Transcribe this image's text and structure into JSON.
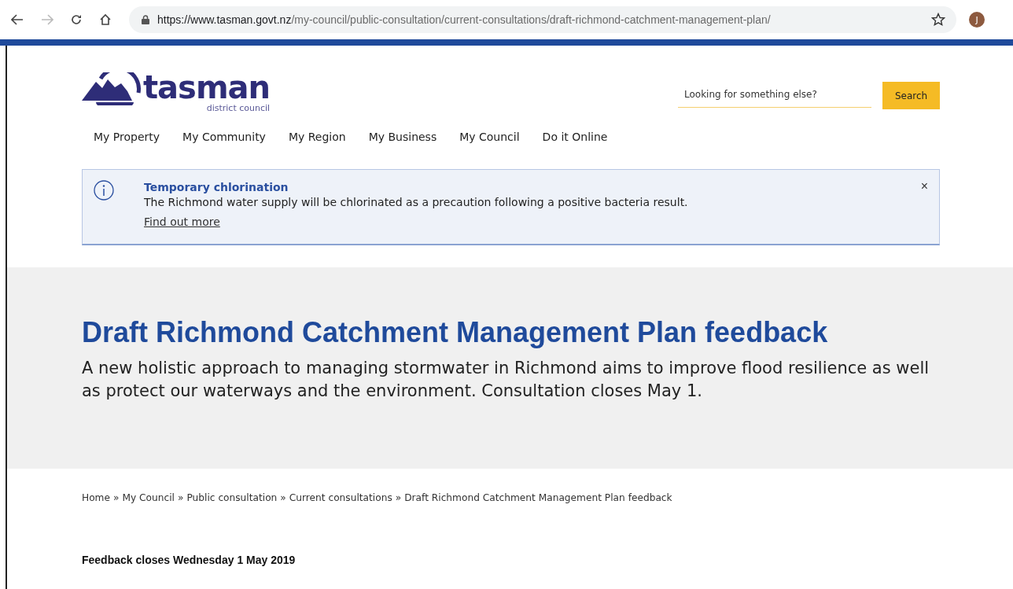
{
  "browser": {
    "url": {
      "host": "https://www.tasman.govt.nz",
      "path": "/my-council/public-consultation/current-consultations/draft-richmond-catchment-management-plan/"
    },
    "bookmarked": false,
    "profile_initial": "J"
  },
  "logo": {
    "name": "tasman",
    "subtitle": "district council"
  },
  "search": {
    "placeholder": "Looking for something else?",
    "button": "Search"
  },
  "nav": [
    "My Property",
    "My Community",
    "My Region",
    "My Business",
    "My Council",
    "Do it Online"
  ],
  "alert": {
    "title": "Temporary chlorination",
    "message": "The Richmond water supply will be chlorinated as a precaution following a positive bacteria result.",
    "link": "Find out more",
    "close": "×"
  },
  "hero": {
    "title": "Draft Richmond Catchment Management Plan feedback",
    "summary": "A new holistic approach to managing stormwater in Richmond aims to improve flood resilience as well as protect our waterways and the environment. Consultation closes May 1."
  },
  "breadcrumb": {
    "separator": "»",
    "items": [
      "Home",
      "My Council",
      "Public consultation",
      "Current consultations",
      "Draft Richmond Catchment Management Plan feedback"
    ]
  },
  "notice": "Feedback closes Wednesday 1 May 2019"
}
